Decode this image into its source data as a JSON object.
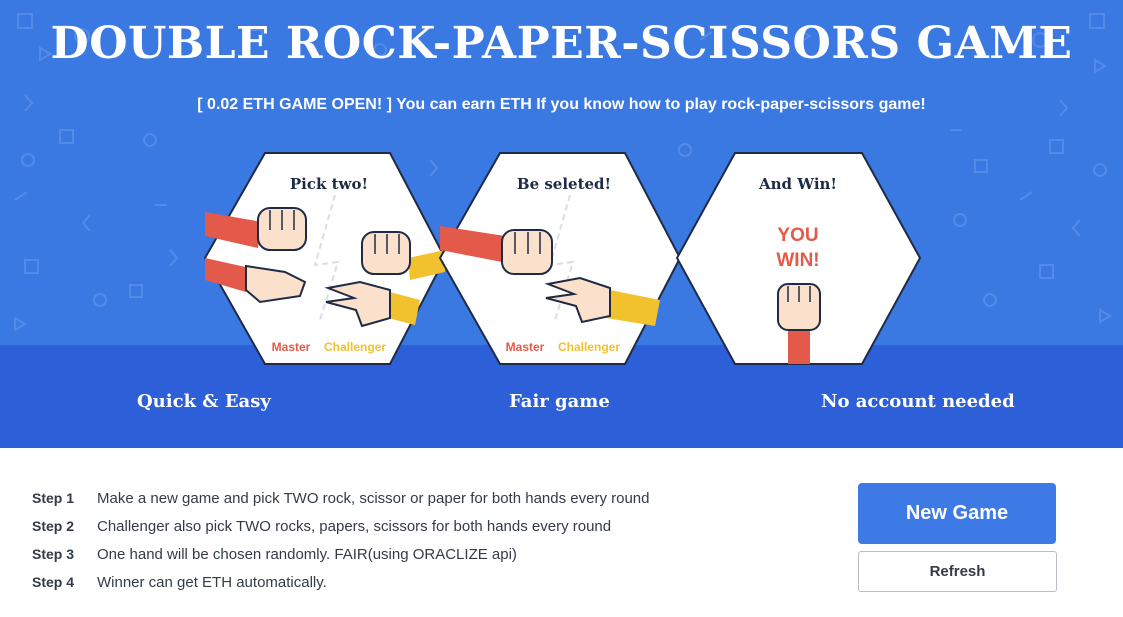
{
  "header": {
    "title": "DOUBLE ROCK-PAPER-SCISSORS GAME",
    "subtitle": "[ 0.02 ETH GAME OPEN! ] You can earn ETH If you know how to play rock-paper-scissors game!"
  },
  "panels": [
    {
      "heading": "Pick two!",
      "master_label": "Master",
      "challenger_label": "Challenger"
    },
    {
      "heading": "Be seleted!",
      "master_label": "Master",
      "challenger_label": "Challenger"
    },
    {
      "heading": "And Win!",
      "win_line1": "YOU",
      "win_line2": "WIN!"
    }
  ],
  "features": [
    "Quick & Easy",
    "Fair game",
    "No account needed"
  ],
  "steps": [
    {
      "label": "Step 1",
      "text": "Make a new game and pick TWO rock, scissor or paper for both hands every round"
    },
    {
      "label": "Step 2",
      "text": "Challenger also pick TWO rocks, papers, scissors for both hands every round"
    },
    {
      "label": "Step 3",
      "text": "One hand will be chosen randomly. FAIR(using ORACLIZE api)"
    },
    {
      "label": "Step 4",
      "text": "Winner can get ETH automatically."
    }
  ],
  "actions": {
    "new_game": "New Game",
    "refresh": "Refresh"
  },
  "colors": {
    "hero_blue": "#3a78e2",
    "band_blue": "#2c5fd8",
    "master_red": "#e45a4a",
    "challenger_yellow": "#f2c12e",
    "button_blue": "#3d7ae6"
  },
  "icons": [
    "fist-icon",
    "paper-hand-icon",
    "scissors-hand-icon",
    "raised-fist-icon"
  ]
}
